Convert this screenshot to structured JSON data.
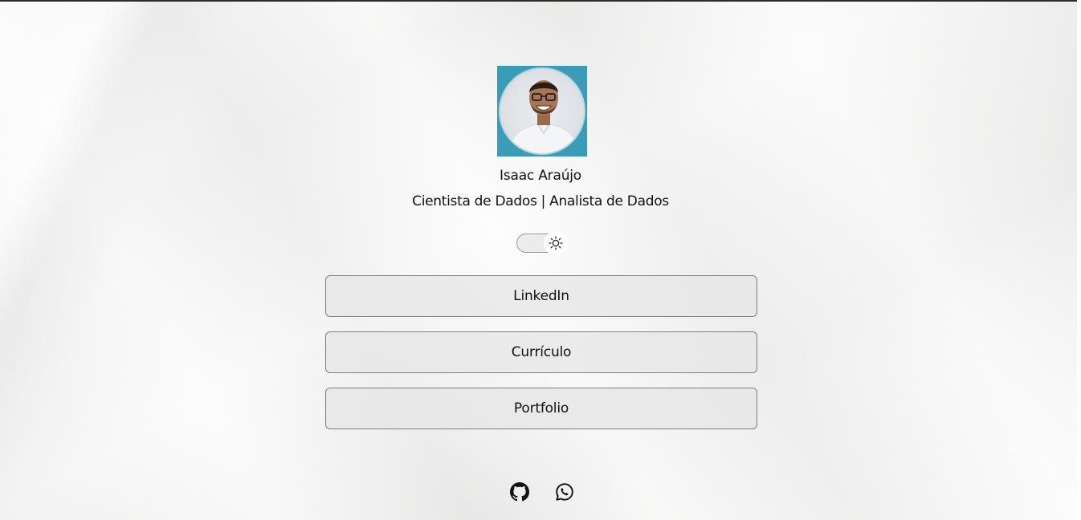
{
  "profile": {
    "name": "Isaac Araújo",
    "subtitle": "Cientista de Dados | Analista de Dados",
    "avatar_icon": "profile-photo"
  },
  "theme_toggle": {
    "icon": "sun-icon",
    "state": "light"
  },
  "links": [
    {
      "label": "LinkedIn"
    },
    {
      "label": "Currículo"
    },
    {
      "label": "Portfolio"
    }
  ],
  "social": [
    {
      "icon": "github-icon"
    },
    {
      "icon": "whatsapp-icon"
    }
  ],
  "colors": {
    "avatar_bg": "#3a9cb6",
    "button_border": "#7e7e7e",
    "text": "#111111"
  }
}
